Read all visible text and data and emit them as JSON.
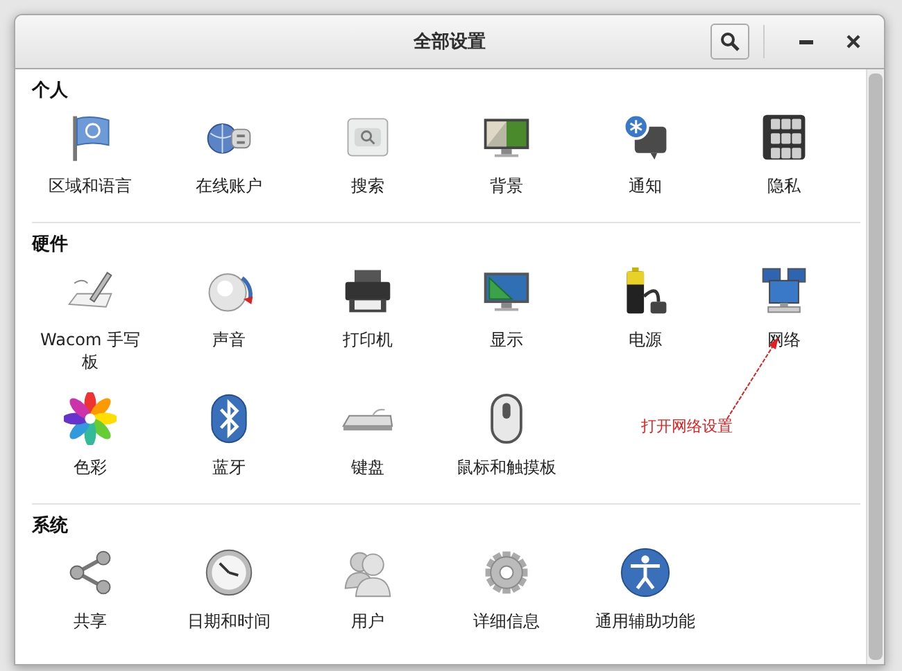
{
  "window": {
    "title": "全部设置"
  },
  "sections": [
    {
      "title": "个人",
      "items": [
        {
          "label": "区域和语言"
        },
        {
          "label": "在线账户"
        },
        {
          "label": "搜索"
        },
        {
          "label": "背景"
        },
        {
          "label": "通知"
        },
        {
          "label": "隐私"
        }
      ]
    },
    {
      "title": "硬件",
      "items": [
        {
          "label": "Wacom 手写板"
        },
        {
          "label": "声音"
        },
        {
          "label": "打印机"
        },
        {
          "label": "显示"
        },
        {
          "label": "电源"
        },
        {
          "label": "网络"
        },
        {
          "label": "色彩"
        },
        {
          "label": "蓝牙"
        },
        {
          "label": "键盘"
        },
        {
          "label": "鼠标和触摸板"
        }
      ]
    },
    {
      "title": "系统",
      "items": [
        {
          "label": "共享"
        },
        {
          "label": "日期和时间"
        },
        {
          "label": "用户"
        },
        {
          "label": "详细信息"
        },
        {
          "label": "通用辅助功能"
        }
      ]
    }
  ],
  "annotation": {
    "text": "打开网络设置"
  }
}
